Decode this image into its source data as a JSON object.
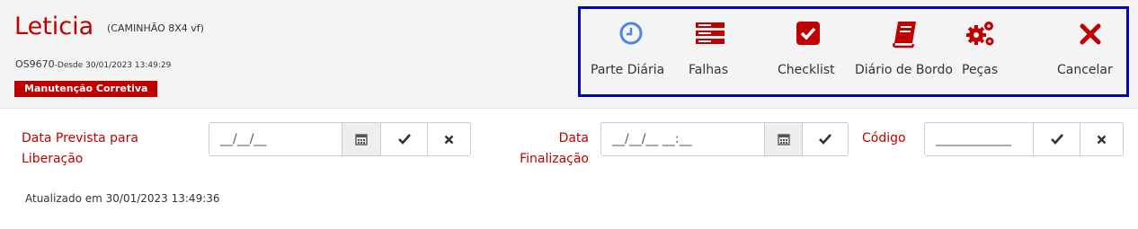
{
  "header": {
    "title": "Leticia",
    "subtitle": "(CAMINHÃO 8X4 vf)",
    "os_number": "OS9670",
    "since": "-Desde 30/01/2023 13:49:29",
    "badge": "Manutenção Corretiva"
  },
  "toolbar": {
    "parte_diaria": "Parte Diária",
    "falhas": "Falhas",
    "checklist": "Checklist",
    "diario_bordo": "Diário de Bordo",
    "pecas": "Peças",
    "cancelar": "Cancelar"
  },
  "form": {
    "prevista_label_1": "Data Prevista para",
    "prevista_label_2": "Liberação",
    "prevista_placeholder": "__/__/__",
    "finalizacao_label_1": "Data",
    "finalizacao_label_2": "Finalização",
    "finalizacao_placeholder": "__/__/__ __:__",
    "codigo_label": "Código",
    "codigo_placeholder": "____________"
  },
  "footer": {
    "updated": "Atualizado em 30/01/2023 13:49:36"
  },
  "colors": {
    "brand_red": "#c00000",
    "toolbar_border": "#0000cc",
    "clock_blue": "#4a86e8"
  }
}
